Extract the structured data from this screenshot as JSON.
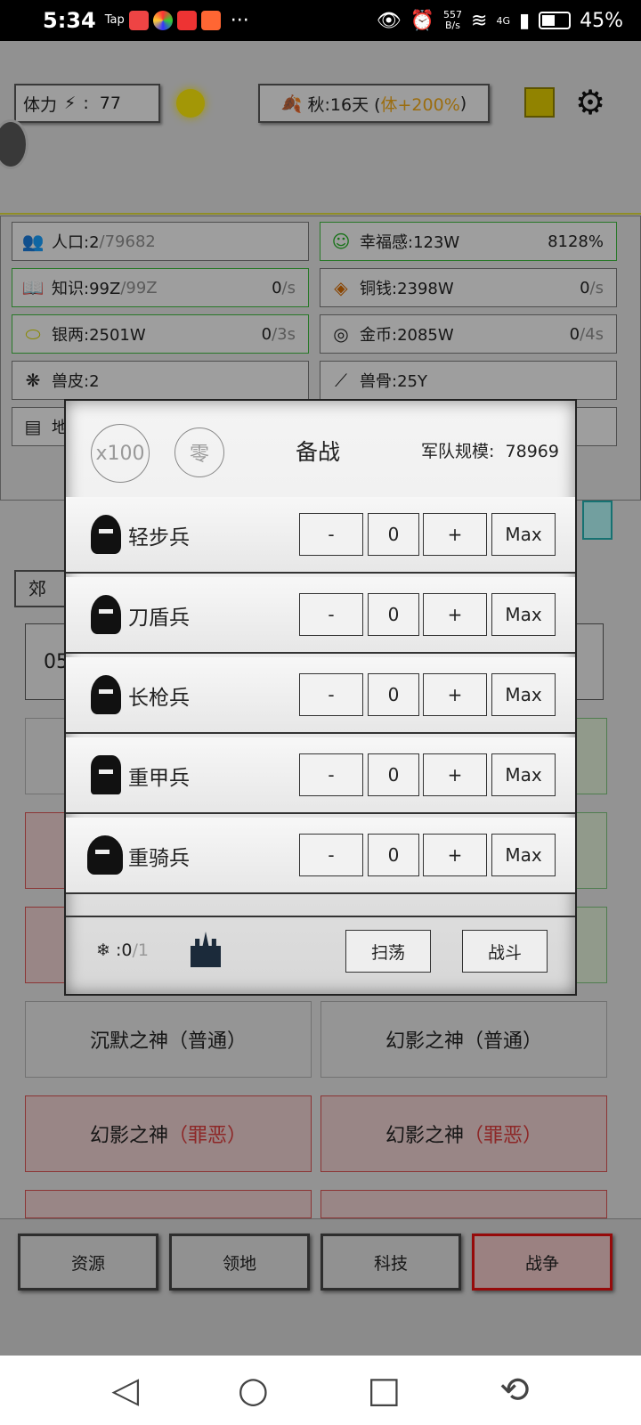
{
  "status": {
    "time": "5:34",
    "apps": [
      "Tap",
      "",
      "",
      "",
      ""
    ],
    "more": "···",
    "speed_top": "557",
    "speed_bottom": "B/s",
    "network": "4G",
    "battery": "45%",
    "battery_level": 0.45
  },
  "header": {
    "stamina_label": "体力",
    "stamina_sep": ":",
    "stamina_value": "77",
    "season_text": "秋:16天 (",
    "season_bonus": "体+200%",
    "season_close": ")"
  },
  "resources": [
    {
      "label": "人口:2",
      "sub": "/79682",
      "rate": "",
      "unit": ""
    },
    {
      "label": "幸福感:123W",
      "sub": "",
      "rate": "8128%",
      "unit": ""
    },
    {
      "label": "知识:99Z",
      "sub": "/99Z",
      "rate": "0",
      "unit": "/s"
    },
    {
      "label": "铜钱:2398W",
      "sub": "",
      "rate": "0",
      "unit": "/s"
    },
    {
      "label": "银两:2501W",
      "sub": "",
      "rate": "0",
      "unit": "/3s"
    },
    {
      "label": "金币:2085W",
      "sub": "",
      "rate": "0",
      "unit": "/4s"
    },
    {
      "label": "兽皮:2",
      "sub": "",
      "rate": "",
      "unit": ""
    },
    {
      "label": "兽骨:25Y",
      "sub": "",
      "rate": "",
      "unit": ""
    },
    {
      "label": "地",
      "sub": "",
      "rate": "",
      "unit": ""
    }
  ],
  "partial": {
    "tab": "郊",
    "field": "05"
  },
  "dungeons": [
    {
      "name": "沉默之神",
      "tag": "（普通）",
      "red": false
    },
    {
      "name": "幻影之神",
      "tag": "（普通）",
      "red": false
    },
    {
      "name": "幻影之神",
      "tag": "（罪恶）",
      "red": true
    },
    {
      "name": "幻影之神",
      "tag": "（罪恶）",
      "red": true
    }
  ],
  "modal": {
    "x100": "x100",
    "zero": "零",
    "title": "备战",
    "army_label": "军队规模:",
    "army_value": "78969",
    "units": [
      {
        "name": "轻步兵",
        "value": "0"
      },
      {
        "name": "刀盾兵",
        "value": "0"
      },
      {
        "name": "长枪兵",
        "value": "0"
      },
      {
        "name": "重甲兵",
        "value": "0"
      },
      {
        "name": "重骑兵",
        "value": "0"
      }
    ],
    "minus": "-",
    "plus": "+",
    "max": "Max",
    "snow_prefix": "❄ :0",
    "snow_total": "/1",
    "sweep": "扫荡",
    "fight": "战斗"
  },
  "nav": [
    "资源",
    "领地",
    "科技",
    "战争"
  ],
  "sysnav": {
    "back": "◁",
    "home": "○",
    "recent": "□",
    "rotate": "⟲"
  }
}
